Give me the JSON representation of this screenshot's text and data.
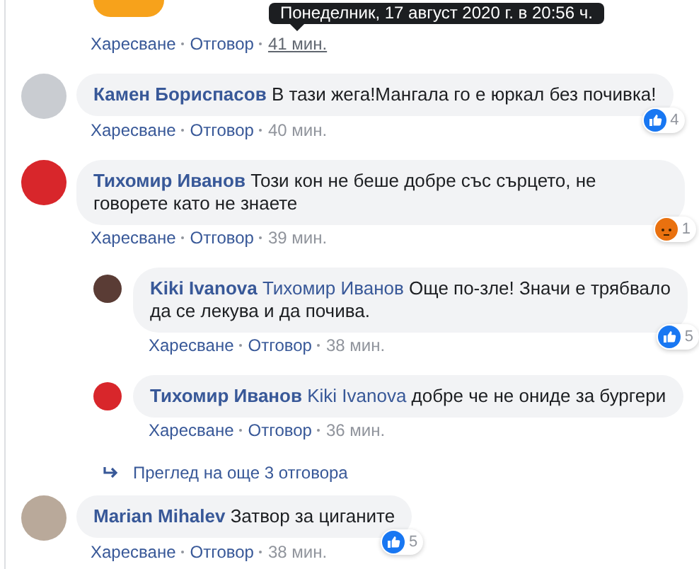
{
  "top_actions": {
    "like": "Харесване",
    "reply": "Отговор",
    "time": "41 мин.",
    "tooltip": "Понеделник, 17 август 2020 г. в 20:56 ч."
  },
  "comments": [
    {
      "kind": "comment",
      "author": "Камен Бориспасов",
      "text": "В тази жега!Мангала го е юркал без почивка!",
      "like": "Харесване",
      "reply": "Отговор",
      "time": "40 мин.",
      "reaction": {
        "kind": "like",
        "count": "4"
      }
    },
    {
      "kind": "comment",
      "author": "Тихомир Иванов",
      "text": "Този кон не беше добре със сърцето, не говорете като не знаете",
      "like": "Харесване",
      "reply": "Отговор",
      "time": "39 мин.",
      "reaction": {
        "kind": "angry",
        "count": "1"
      }
    },
    {
      "kind": "reply",
      "author": "Kiki Ivanova",
      "mention": "Тихомир Иванов",
      "text": "Още по-зле! Значи е трябвало да се лекува и да почива.",
      "like": "Харесване",
      "reply": "Отговор",
      "time": "38 мин.",
      "reaction": {
        "kind": "like",
        "count": "5"
      }
    },
    {
      "kind": "reply",
      "author": "Тихомир Иванов",
      "mention": "Kiki Ivanova",
      "text": "добре че не ониде за бургери",
      "like": "Харесване",
      "reply": "Отговор",
      "time": "36 мин."
    },
    {
      "kind": "more",
      "text": "Преглед на още 3 отговора"
    },
    {
      "kind": "comment",
      "author": "Marian Mihalev",
      "text": "Затвор за циганите",
      "like": "Харесване",
      "reply": "Отговор",
      "time": "38 мин.",
      "reaction": {
        "kind": "like",
        "count": "5"
      }
    }
  ]
}
